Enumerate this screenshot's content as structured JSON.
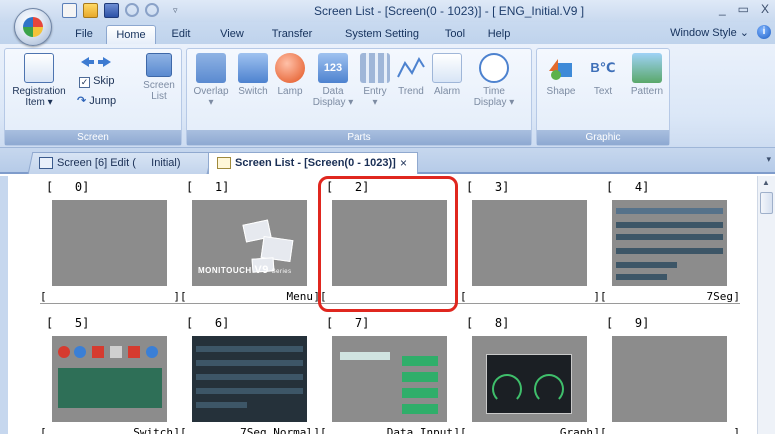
{
  "titlebar": {
    "title": "Screen List - [Screen(0 - 1023)] - [ ENG_Initial.V9 ]",
    "minimize": "_",
    "restore": "▭",
    "close": "X",
    "qat_dropdown": "▿"
  },
  "menu": {
    "tabs": [
      {
        "label": "File"
      },
      {
        "label": "Home",
        "active": true
      },
      {
        "label": "Edit"
      },
      {
        "label": "View"
      },
      {
        "label": "Transfer"
      },
      {
        "label": "System Setting"
      },
      {
        "label": "Tool"
      },
      {
        "label": "Help"
      }
    ],
    "window_style": "Window Style ⌄",
    "help_icon": "i"
  },
  "ribbon": {
    "screen_group": {
      "label": "Screen",
      "registration": "Registration",
      "item": "Item ▾",
      "skip": "Skip",
      "jump": "Jump",
      "screen": "Screen",
      "list": "List"
    },
    "parts_group": {
      "label": "Parts",
      "items": [
        "Overlap",
        "Switch",
        "Lamp",
        "Data",
        "Entry",
        "Trend",
        "Alarm",
        "Time"
      ],
      "data_sub": "Display ▾",
      "entry_sub": "▾",
      "time_sub": "Display ▾",
      "overlap_sub": "▾",
      "data_icon_text": "123"
    },
    "graphic_group": {
      "label": "Graphic",
      "items": [
        "Shape",
        "Text",
        "Pattern"
      ],
      "text_icon_text": "B℃"
    }
  },
  "doc_tabs": {
    "tab1": "Screen [6] Edit (     Initial)",
    "tab2": "Screen List - [Screen(0 - 1023)]",
    "close": "×",
    "dropdown": "▾"
  },
  "screens": [
    {
      "num": "[   0]",
      "name": ""
    },
    {
      "num": "[   1]",
      "name": "Menu"
    },
    {
      "num": "[   2]",
      "name": ""
    },
    {
      "num": "[   3]",
      "name": ""
    },
    {
      "num": "[   4]",
      "name": "7Seg"
    },
    {
      "num": "[   5]",
      "name": "Switch"
    },
    {
      "num": "[   6]",
      "name": "7Seg Normal"
    },
    {
      "num": "[   7]",
      "name": "Data Input"
    },
    {
      "num": "[   8]",
      "name": "Graph"
    },
    {
      "num": "[   9]",
      "name": ""
    }
  ],
  "thumb_text": {
    "monitouch": "MONITOUCH",
    "v9": "V9",
    "series": "Series"
  },
  "colors": {
    "selection_highlight": "#e0271f",
    "empty_thumb": "#8c8c8c"
  }
}
